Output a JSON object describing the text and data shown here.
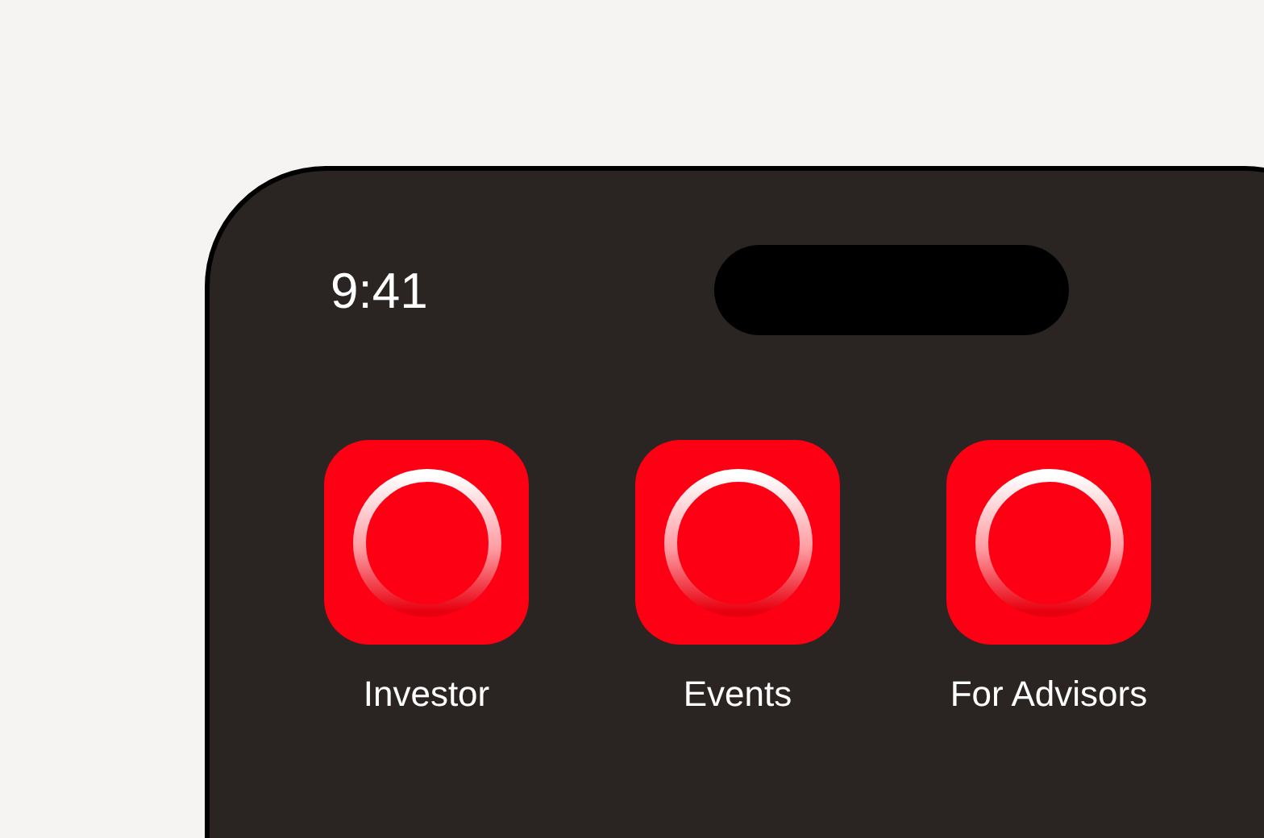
{
  "status_bar": {
    "time": "9:41"
  },
  "apps": [
    {
      "label": "Investor"
    },
    {
      "label": "Events"
    },
    {
      "label": "For Advisors"
    }
  ]
}
